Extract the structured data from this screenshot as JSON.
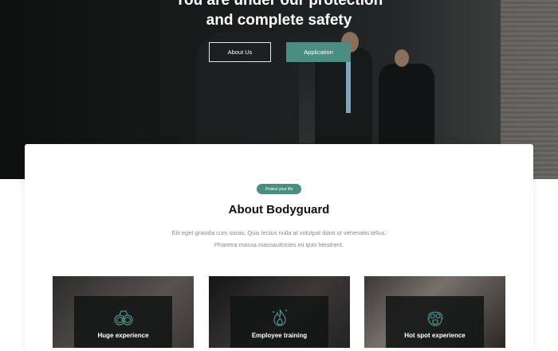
{
  "hero": {
    "title_line1": "You are under our protection",
    "title_line2": "and complete safety",
    "about_button": "About Us",
    "application_button": "Application"
  },
  "about": {
    "badge": "Protect your life",
    "title": "About Bodyguard",
    "description_line1": "Elit eget gravida cum sociis. Quis lectus nulla at volutpat diam ut venenatis tellus.",
    "description_line2": "Pharetra massa massaultricies mi quis hendrerit."
  },
  "features": [
    {
      "label": "Huge experience",
      "icon": "handcuffs-icon"
    },
    {
      "label": "Employee training",
      "icon": "fire-training-icon"
    },
    {
      "label": "Hot spot experience",
      "icon": "gas-mask-icon"
    }
  ],
  "colors": {
    "accent": "#4a8d82",
    "title_text": "#111111",
    "body_text": "#8a8a8a"
  }
}
